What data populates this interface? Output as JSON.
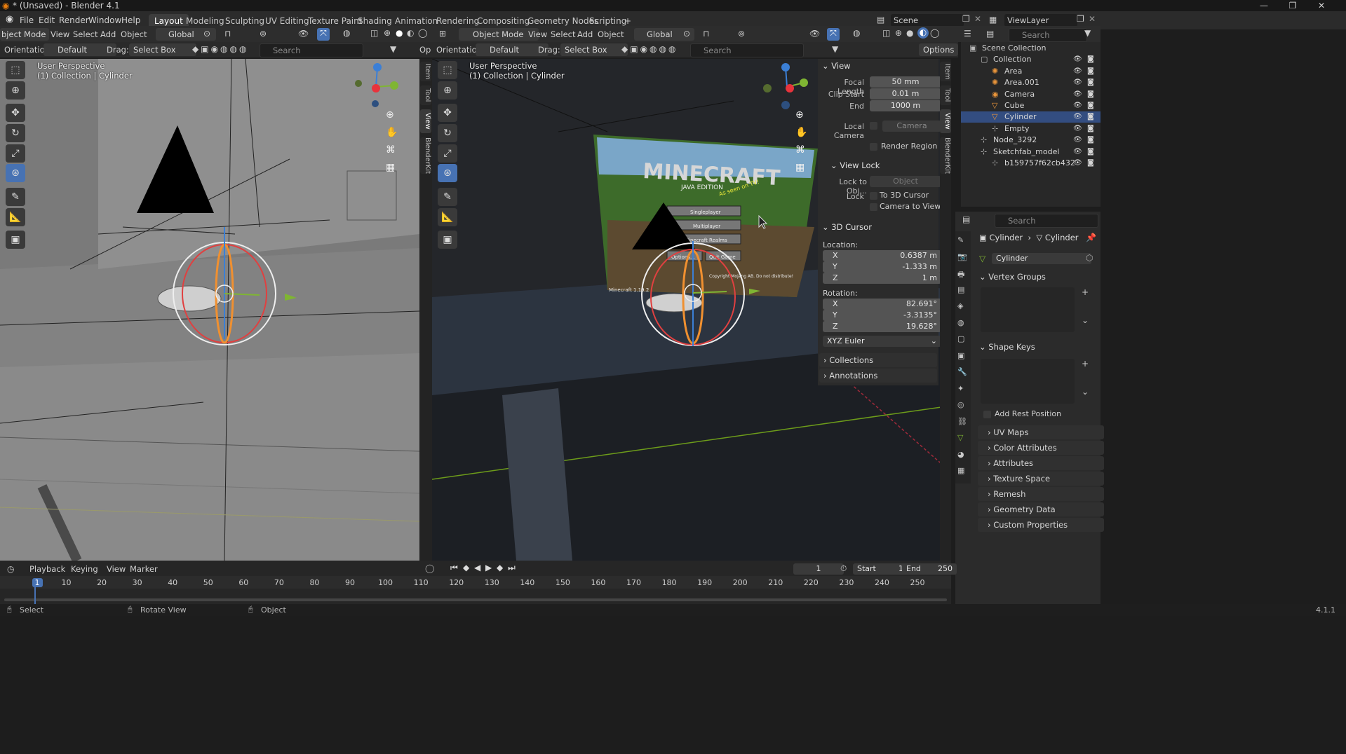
{
  "window": {
    "title": "* (Unsaved) - Blender 4.1"
  },
  "menus": [
    "File",
    "Edit",
    "Render",
    "Window",
    "Help"
  ],
  "workspaces": [
    "Layout",
    "Modeling",
    "Sculpting",
    "UV Editing",
    "Texture Paint",
    "Shading",
    "Animation",
    "Rendering",
    "Compositing",
    "Geometry Nodes",
    "Scripting"
  ],
  "active_workspace": "Layout",
  "scene": {
    "label": "Scene",
    "viewlayer": "ViewLayer"
  },
  "left_view": {
    "mode": "bject Mode",
    "menus": [
      "View",
      "Select",
      "Add",
      "Object"
    ],
    "transform": "Global",
    "orientation_label": "Orientation:",
    "orientation": "Default",
    "drag_label": "Drag:",
    "drag": "Select Box",
    "search": "Search",
    "op": "Op",
    "persp": "User Perspective",
    "collection": "(1) Collection | Cylinder",
    "tabs": [
      "Item",
      "Tool",
      "View",
      "BlenderKit"
    ]
  },
  "right_view": {
    "mode": "Object Mode",
    "menus": [
      "View",
      "Select",
      "Add",
      "Object"
    ],
    "transform": "Global",
    "orientation_label": "Orientation:",
    "orientation": "Default",
    "drag_label": "Drag:",
    "drag": "Select Box",
    "search": "Search",
    "options": "Options",
    "persp": "User Perspective",
    "collection": "(1) Collection | Cylinder",
    "tabs": [
      "Item",
      "Tool",
      "View",
      "BlenderKit"
    ],
    "screen_title": "MINECRAFT",
    "screen_sub": "JAVA EDITION",
    "screen_splash": "As seen on TV!",
    "screen_btn1": "Singleplayer",
    "screen_btn2": "Multiplayer",
    "screen_btn3": "Minecraft Realms",
    "screen_btn4": "Options...",
    "screen_btn5": "Quit Game",
    "screen_version": "Minecraft 1.19.2",
    "screen_copyright": "Copyright Mojang AB. Do not distribute!"
  },
  "npanel": {
    "view_header": "View",
    "focal_label": "Focal Length",
    "focal": "50 mm",
    "clip_start_label": "Clip Start",
    "clip_start": "0.01 m",
    "end_label": "End",
    "end": "1000 m",
    "local_camera_label": "Local Camera",
    "local_camera": "Camera",
    "render_region": "Render Region",
    "view_lock_header": "View Lock",
    "lock_obj_label": "Lock to Obj...",
    "lock_obj": "Object",
    "lock_label": "Lock",
    "to_cursor": "To 3D Cursor",
    "cam_to_view": "Camera to View",
    "cursor_header": "3D Cursor",
    "location_label": "Location:",
    "loc_x": "0.6387 m",
    "loc_y": "-1.333 m",
    "loc_z": "1 m",
    "rotation_label": "Rotation:",
    "rot_x": "82.691°",
    "rot_y": "-3.3135°",
    "rot_z": "19.628°",
    "x": "X",
    "y": "Y",
    "z": "Z",
    "euler": "XYZ Euler",
    "collections": "Collections",
    "annotations": "Annotations"
  },
  "outliner": {
    "search": "Search",
    "items": [
      {
        "label": "Scene Collection",
        "indent": 0
      },
      {
        "label": "Collection",
        "indent": 1
      },
      {
        "label": "Area",
        "indent": 2
      },
      {
        "label": "Area.001",
        "indent": 2
      },
      {
        "label": "Camera",
        "indent": 2
      },
      {
        "label": "Cube",
        "indent": 2
      },
      {
        "label": "Cylinder",
        "indent": 2,
        "selected": true
      },
      {
        "label": "Empty",
        "indent": 2
      },
      {
        "label": "Node_3292",
        "indent": 1
      },
      {
        "label": "Sketchfab_model",
        "indent": 1
      },
      {
        "label": "b159757f62cb432",
        "indent": 2
      }
    ]
  },
  "properties": {
    "search": "Search",
    "breadcrumb_obj": "Cylinder",
    "breadcrumb_data": "Cylinder",
    "mesh_name": "Cylinder",
    "vertex_groups": "Vertex Groups",
    "shape_keys": "Shape Keys",
    "add_rest": "Add Rest Position",
    "sections": [
      "UV Maps",
      "Color Attributes",
      "Attributes",
      "Texture Space",
      "Remesh",
      "Geometry Data",
      "Custom Properties"
    ]
  },
  "timeline": {
    "menus": [
      "Playback",
      "Keying",
      "View",
      "Marker"
    ],
    "current": "1",
    "start_label": "Start",
    "start": "1",
    "end_label": "End",
    "end": "250",
    "ticks": [
      "1",
      "10",
      "20",
      "30",
      "40",
      "50",
      "60",
      "70",
      "80",
      "90",
      "100",
      "110",
      "120",
      "130",
      "140",
      "150",
      "160",
      "170",
      "180",
      "190",
      "200",
      "210",
      "220",
      "230",
      "240",
      "250"
    ]
  },
  "status": {
    "select": "Select",
    "rotate": "Rotate View",
    "object": "Object",
    "version": "4.1.1"
  },
  "colors": {
    "accent": "#4772b3",
    "x_axis": "#e8333c",
    "y_axis": "#7fb533",
    "z_axis": "#3b7fd6",
    "select_orange": "#f09030"
  }
}
